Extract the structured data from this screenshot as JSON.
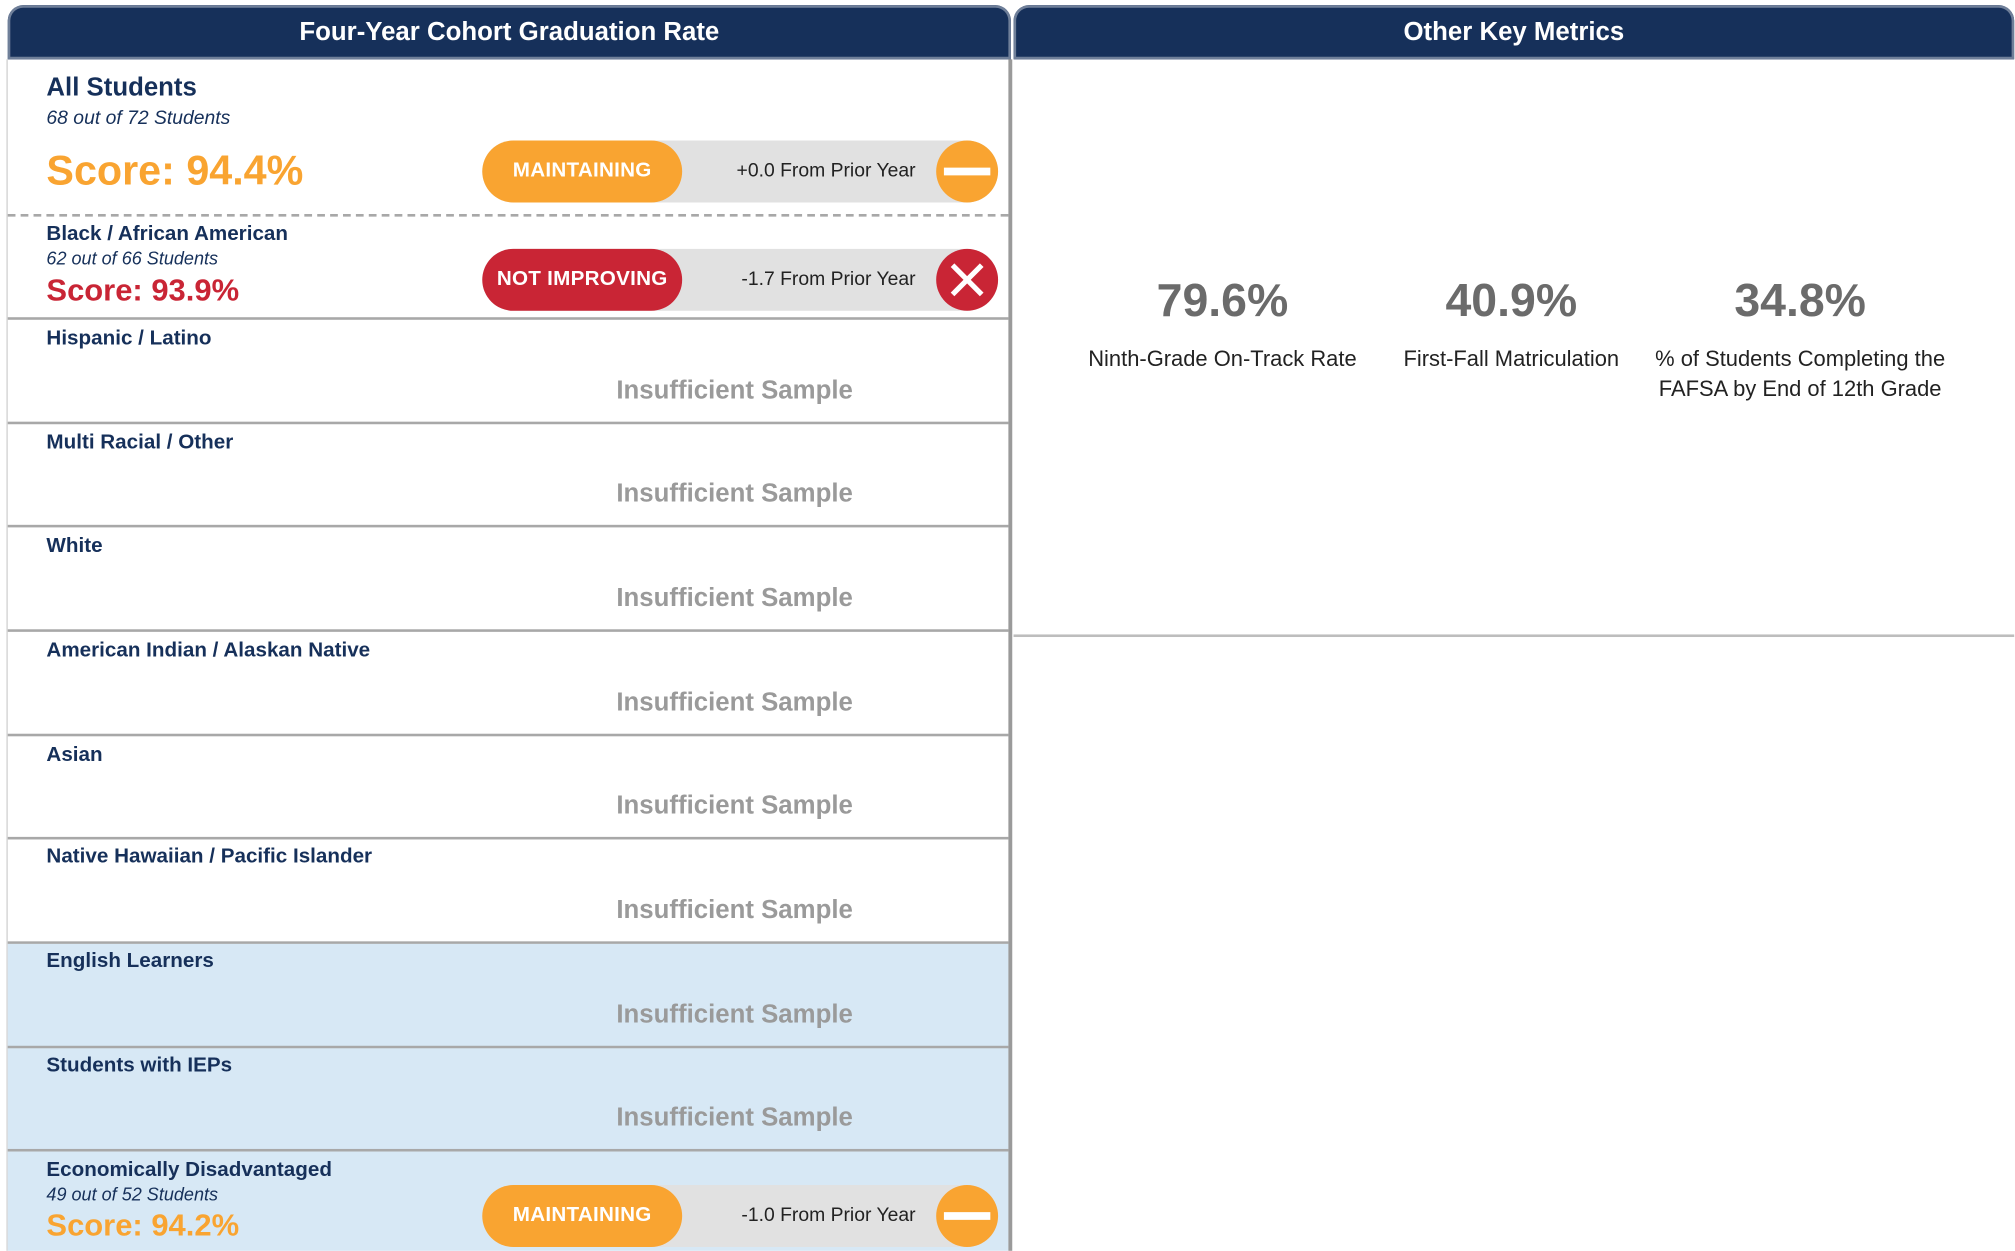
{
  "graduation_panel": {
    "title": "Four-Year Cohort Graduation Rate",
    "groups": [
      {
        "name": "All Students",
        "count": "68 out of 72 Students",
        "score": "Score: 94.4%",
        "status": "MAINTAINING",
        "change": "+0.0 From Prior Year",
        "icon": "minus-icon"
      },
      {
        "name": "Black / African American",
        "count": "62 out of 66 Students",
        "score": "Score: 93.9%",
        "status": "NOT IMPROVING",
        "change": "-1.7 From Prior Year",
        "icon": "x-icon"
      },
      {
        "name": "Hispanic / Latino",
        "note": "Insufficient Sample"
      },
      {
        "name": "Multi Racial / Other",
        "note": "Insufficient Sample"
      },
      {
        "name": "White",
        "note": "Insufficient Sample"
      },
      {
        "name": "American Indian / Alaskan Native",
        "note": "Insufficient Sample"
      },
      {
        "name": "Asian",
        "note": "Insufficient Sample"
      },
      {
        "name": "Native Hawaiian / Pacific Islander",
        "note": "Insufficient Sample"
      },
      {
        "name": "English Learners",
        "note": "Insufficient Sample"
      },
      {
        "name": "Students with IEPs",
        "note": "Insufficient Sample"
      },
      {
        "name": "Economically Disadvantaged",
        "count": "49 out of 52 Students",
        "score": "Score: 94.2%",
        "status": "MAINTAINING",
        "change": "-1.0 From Prior Year",
        "icon": "minus-icon"
      }
    ]
  },
  "metrics_panel": {
    "title": "Other Key Metrics",
    "metrics": [
      {
        "value": "79.6%",
        "label": "Ninth-Grade On-Track Rate"
      },
      {
        "value": "40.9%",
        "label": "First-Fall Matriculation"
      },
      {
        "value": "34.8%",
        "label": "% of Students Completing the FAFSA by End of 12th Grade"
      }
    ]
  },
  "colors": {
    "header_navy": "#16305a",
    "maintaining_orange": "#f9a431",
    "not_improving_red": "#c92535",
    "shaded_row_blue": "#d7e8f5"
  }
}
